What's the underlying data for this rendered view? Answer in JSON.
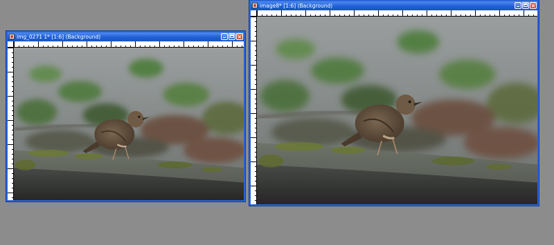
{
  "windows": [
    {
      "title": "img_0271 1* [1:6] (Background)",
      "controls": {
        "minimize": "minimize-icon",
        "maximize": "maximize-icon",
        "close": "close-icon"
      }
    },
    {
      "title": "image8* [1:6] (Background)",
      "controls": {
        "minimize": "minimize-icon",
        "maximize": "maximize-icon",
        "close": "close-icon"
      }
    }
  ],
  "colors": {
    "desktop": "#8c8c8c",
    "titlebar": "#2a64d8",
    "close_button": "#c93d1b"
  }
}
